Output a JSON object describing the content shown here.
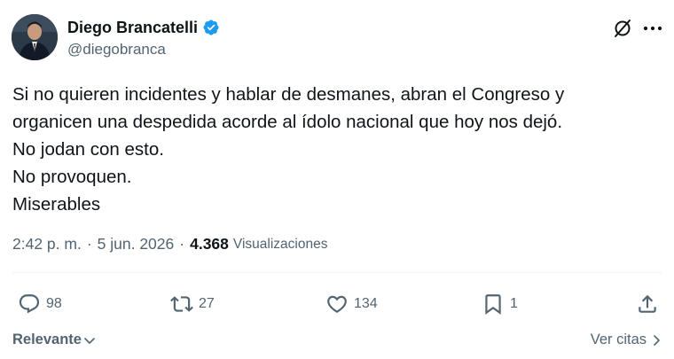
{
  "author": {
    "name": "Diego Brancatelli",
    "handle": "@diegobranca",
    "verified": true,
    "verified_color": "#1d9bf0"
  },
  "tweet": {
    "lines": [
      "Si no quieren incidentes y hablar de desmanes, abran el Congreso y",
      "organicen una despedida acorde al ídolo nacional que hoy nos dejó.",
      "No jodan con esto.",
      "No provoquen.",
      "Miserables"
    ]
  },
  "meta": {
    "time": "2:42 p. m.",
    "separator": "·",
    "date": "5 jun. 2026",
    "views_count": "4.368",
    "views_label": "Visualizaciones"
  },
  "actions": {
    "replies": "98",
    "retweets": "27",
    "likes": "134",
    "bookmarks": "1"
  },
  "footer": {
    "sort_label": "Relevante",
    "quotes_label": "Ver citas"
  },
  "colors": {
    "text": "#0f1419",
    "secondary": "#536471",
    "divider": "#eff3f4",
    "accent": "#1d9bf0"
  },
  "icons": {
    "grok": "grok-slash-circle-icon",
    "more": "more-horizontal-icon",
    "reply": "reply-bubble-icon",
    "retweet": "retweet-icon",
    "like": "heart-icon",
    "bookmark": "bookmark-icon",
    "share": "share-icon"
  }
}
